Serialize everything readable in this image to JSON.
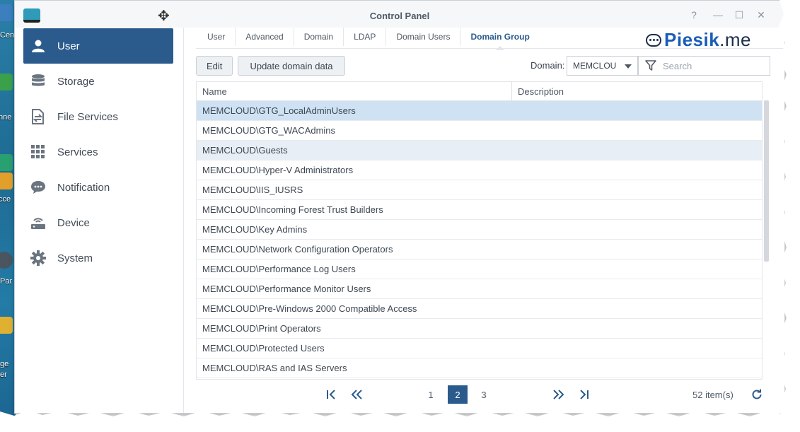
{
  "window": {
    "title": "Control Panel",
    "controls": [
      "?",
      "—",
      "☐",
      "✕"
    ]
  },
  "desktop": {
    "labels": [
      "Cen",
      "nne",
      "cce",
      "Par",
      "ge",
      "er"
    ]
  },
  "logo": {
    "brand": "Piesik",
    "tld": ".me",
    "icon": "speech-bubble-icon"
  },
  "sidebar": {
    "items": [
      {
        "label": "User",
        "icon": "user-icon",
        "active": true
      },
      {
        "label": "Storage",
        "icon": "database-icon",
        "active": false
      },
      {
        "label": "File Services",
        "icon": "file-transfer-icon",
        "active": false
      },
      {
        "label": "Services",
        "icon": "grid-icon",
        "active": false
      },
      {
        "label": "Notification",
        "icon": "chat-bubble-icon",
        "active": false
      },
      {
        "label": "Device",
        "icon": "router-icon",
        "active": false
      },
      {
        "label": "System",
        "icon": "gear-icon",
        "active": false
      }
    ]
  },
  "tabs": [
    {
      "label": "User",
      "active": false
    },
    {
      "label": "Advanced",
      "active": false
    },
    {
      "label": "Domain",
      "active": false
    },
    {
      "label": "LDAP",
      "active": false
    },
    {
      "label": "Domain Users",
      "active": false
    },
    {
      "label": "Domain Group",
      "active": true
    }
  ],
  "toolbar": {
    "edit_label": "Edit",
    "update_label": "Update domain data",
    "domain_label": "Domain:",
    "domain_value": "MEMCLOU",
    "search_placeholder": "Search"
  },
  "grid": {
    "columns": [
      "Name",
      "Description"
    ],
    "rows": [
      {
        "name": "MEMCLOUD\\GTG_LocalAdminUsers",
        "description": "",
        "state": "selected"
      },
      {
        "name": "MEMCLOUD\\GTG_WACAdmins",
        "description": "",
        "state": ""
      },
      {
        "name": "MEMCLOUD\\Guests",
        "description": "",
        "state": "hover"
      },
      {
        "name": "MEMCLOUD\\Hyper-V Administrators",
        "description": "",
        "state": ""
      },
      {
        "name": "MEMCLOUD\\IIS_IUSRS",
        "description": "",
        "state": ""
      },
      {
        "name": "MEMCLOUD\\Incoming Forest Trust Builders",
        "description": "",
        "state": ""
      },
      {
        "name": "MEMCLOUD\\Key Admins",
        "description": "",
        "state": ""
      },
      {
        "name": "MEMCLOUD\\Network Configuration Operators",
        "description": "",
        "state": ""
      },
      {
        "name": "MEMCLOUD\\Performance Log Users",
        "description": "",
        "state": ""
      },
      {
        "name": "MEMCLOUD\\Performance Monitor Users",
        "description": "",
        "state": ""
      },
      {
        "name": "MEMCLOUD\\Pre-Windows 2000 Compatible Access",
        "description": "",
        "state": ""
      },
      {
        "name": "MEMCLOUD\\Print Operators",
        "description": "",
        "state": ""
      },
      {
        "name": "MEMCLOUD\\Protected Users",
        "description": "",
        "state": ""
      },
      {
        "name": "MEMCLOUD\\RAS and IAS Servers",
        "description": "",
        "state": ""
      }
    ]
  },
  "pager": {
    "pages": [
      "1",
      "2",
      "3"
    ],
    "current_page": "2",
    "count": "52 item(s)"
  },
  "colors": {
    "accent": "#2b5b8c",
    "selected_row": "#cfe2f3",
    "logo_blue": "#1a5db8"
  }
}
